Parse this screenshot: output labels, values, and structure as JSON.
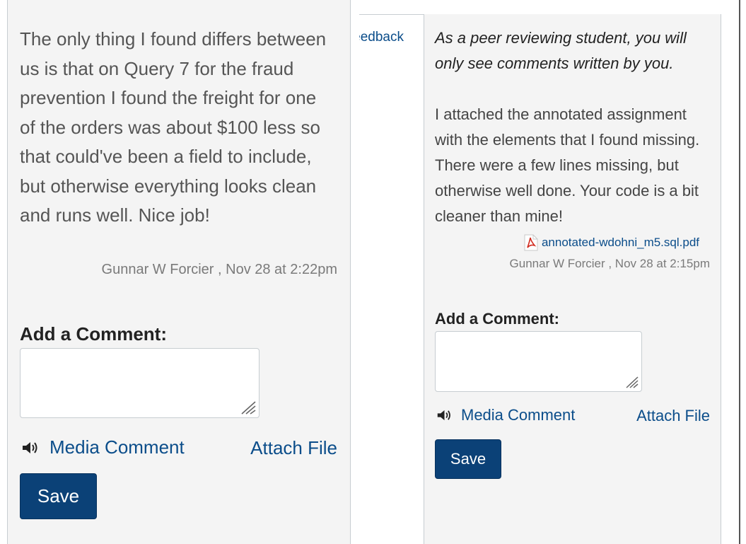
{
  "left": {
    "comment_text": "The only thing I found differs between us is that on Query 7 for the fraud prevention I found the freight for one of the orders was about $100 less so that could've been a field to include, but otherwise everything looks clean and runs well. Nice job!",
    "meta": "Gunnar W Forcier , Nov 28 at 2:22pm",
    "add_comment_label": "Add a Comment:",
    "media_comment_label": "Media Comment",
    "attach_file_label": "Attach File",
    "save_label": "Save"
  },
  "middle": {
    "feedback_link": "Feedback"
  },
  "right": {
    "note": "As a peer reviewing student, you will only see comments written by you.",
    "comment_text": "I attached the annotated assignment with the elements that I found missing. There were a few lines missing, but otherwise well done. Your code is a bit cleaner than mine!",
    "attachment_name": "annotated-wdohni_m5.sql.pdf",
    "meta": "Gunnar W Forcier , Nov 28 at 2:15pm",
    "add_comment_label": "Add a Comment:",
    "media_comment_label": "Media Comment",
    "attach_file_label": "Attach File",
    "save_label": "Save"
  },
  "icons": {
    "speaker": "speaker-icon",
    "pdf": "pdf-icon",
    "resize": "resize-grip-icon"
  },
  "colors": {
    "link": "#0b4d8a",
    "button_bg": "#0b4177",
    "panel_bg": "#f4f4f4"
  }
}
